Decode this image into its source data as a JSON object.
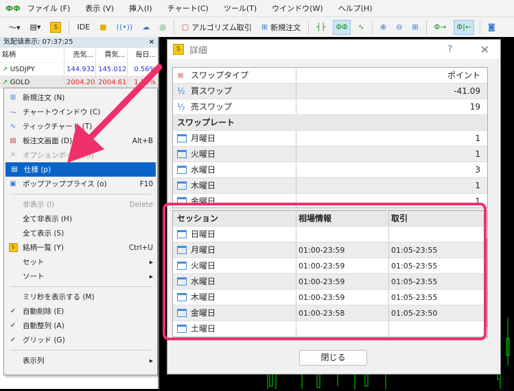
{
  "menubar": {
    "items": [
      "ファイル (F)",
      "表示 (V)",
      "挿入(I)",
      "チャート(C)",
      "ツール(T)",
      "ウインドウ(W)",
      "ヘルプ(H)"
    ]
  },
  "toolbar": {
    "ide": "IDE",
    "algo": "アルゴリズム取引",
    "new_order": "新規注文"
  },
  "market_watch": {
    "title": "気配値表示: 07:37:25",
    "close": "×",
    "columns": [
      "銘柄",
      "売気...",
      "買気...",
      "毎日..."
    ],
    "rows": [
      {
        "symbol": "USDJPY",
        "bid": "144.932",
        "ask": "145.012",
        "daily": "0.56%"
      },
      {
        "symbol": "GOLD",
        "bid": "2004.20",
        "ask": "2004.61",
        "daily": "1.19%"
      }
    ]
  },
  "context_menu": {
    "items": [
      {
        "label": "新規注文 (N)",
        "shortcut": "",
        "icon": "new-order"
      },
      {
        "label": "チャートウインドウ (C)",
        "shortcut": "",
        "icon": "chart"
      },
      {
        "label": "ティックチャート (T)",
        "shortcut": "",
        "icon": "tick"
      },
      {
        "label": "板注文画面 (D)",
        "shortcut": "Alt+B",
        "icon": "dom"
      },
      {
        "label": "オプションボード (O)",
        "shortcut": "",
        "icon": "option"
      },
      {
        "label": "仕様 (p)",
        "shortcut": "",
        "icon": "spec"
      },
      {
        "label": "ポップアッププライス (o)",
        "shortcut": "F10",
        "icon": "popup"
      },
      {
        "label": "非表示 (I)",
        "shortcut": "Delete"
      },
      {
        "label": "全て非表示 (H)",
        "shortcut": ""
      },
      {
        "label": "全て表示 (S)",
        "shortcut": ""
      },
      {
        "label": "銘柄一覧 (Y)",
        "shortcut": "Ctrl+U"
      },
      {
        "label": "セット",
        "shortcut": "▸"
      },
      {
        "label": "ソート",
        "shortcut": "▸"
      },
      {
        "label": "ミリ秒を表示する (M)",
        "shortcut": ""
      },
      {
        "label": "自動削除 (E)",
        "shortcut": "",
        "check": "✓"
      },
      {
        "label": "自動整列 (A)",
        "shortcut": "",
        "check": "✓"
      },
      {
        "label": "グリッド (G)",
        "shortcut": "",
        "check": "✓"
      },
      {
        "label": "表示列",
        "shortcut": "▸"
      }
    ]
  },
  "dialog": {
    "title": "詳細",
    "help": "?",
    "close": "✕",
    "close_button": "閉じる",
    "props": [
      {
        "k": "スワップタイプ",
        "v": "ポイント",
        "icon": "≡"
      },
      {
        "k": "買スワップ",
        "v": "-41.09",
        "icon": "½"
      },
      {
        "k": "売スワップ",
        "v": "19",
        "icon": "½"
      },
      {
        "k": "スワップレート",
        "v": "",
        "header": true
      },
      {
        "k": "月曜日",
        "v": "1"
      },
      {
        "k": "火曜日",
        "v": "1"
      },
      {
        "k": "水曜日",
        "v": "3"
      },
      {
        "k": "木曜日",
        "v": "1"
      },
      {
        "k": "金曜日",
        "v": "1"
      }
    ],
    "sessions": {
      "columns": [
        "セッション",
        "相場情報",
        "取引"
      ],
      "rows": [
        {
          "day": "日曜日",
          "quote": "",
          "trade": ""
        },
        {
          "day": "月曜日",
          "quote": "01:00-23:59",
          "trade": "01:05-23:55"
        },
        {
          "day": "火曜日",
          "quote": "01:00-23:59",
          "trade": "01:05-23:55"
        },
        {
          "day": "水曜日",
          "quote": "01:00-23:59",
          "trade": "01:05-23:55"
        },
        {
          "day": "木曜日",
          "quote": "01:00-23:59",
          "trade": "01:05-23:55"
        },
        {
          "day": "金曜日",
          "quote": "01:00-23:58",
          "trade": "01:05-23:50"
        },
        {
          "day": "土曜日",
          "quote": "",
          "trade": ""
        }
      ]
    }
  },
  "colors": {
    "highlight": "#f0306a",
    "selection": "#0a64c8",
    "bid_blue": "#2a2ae0",
    "ask_red": "#e02a2a"
  }
}
